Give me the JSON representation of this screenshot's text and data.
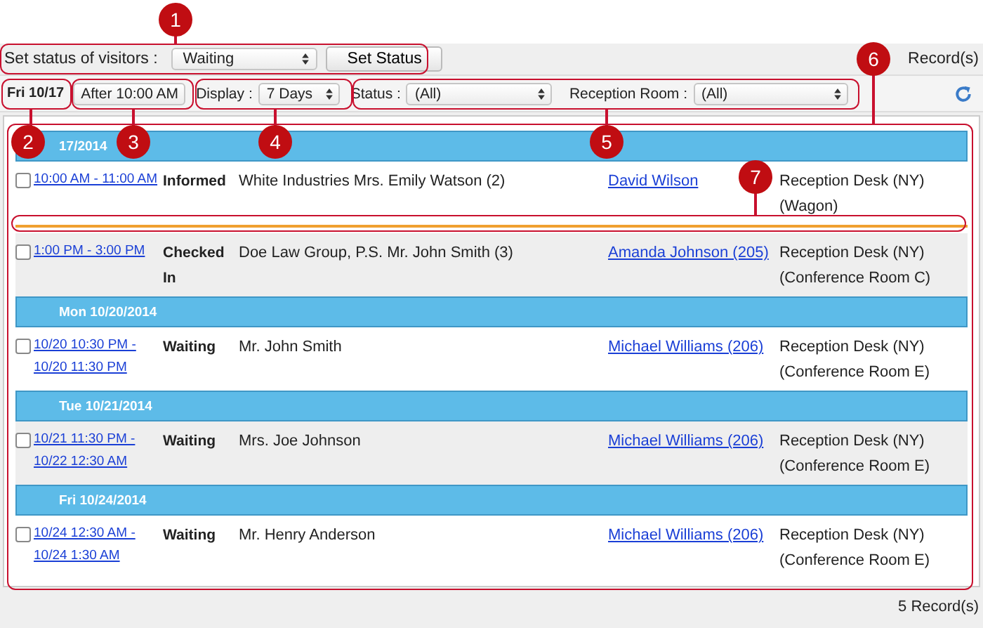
{
  "status_bar": {
    "label": "Set status of visitors :",
    "select": "Waiting",
    "button": "Set Status",
    "records_top": "Record(s)"
  },
  "filters": {
    "date": "Fri 10/17",
    "time": "After 10:00 AM",
    "display_label": "Display :",
    "display": "7 Days",
    "status_label": "Status :",
    "status": "(All)",
    "room_label": "Reception Room :",
    "room": "(All)"
  },
  "groups": [
    {
      "date": "17/2014",
      "rows": [
        {
          "checked": false,
          "time": [
            "10:00 AM - 11:00 AM"
          ],
          "status": "Informed",
          "visitor": "White Industries Mrs. Emily Watson (2)",
          "host": "David Wilson",
          "location": [
            "Reception Desk (NY)",
            "(Wagon)"
          ]
        },
        {
          "checked": false,
          "time": [
            "1:00 PM - 3:00 PM"
          ],
          "status": "Checked In",
          "visitor": "Doe Law Group, P.S. Mr. John Smith (3)",
          "host": "Amanda Johnson (205)",
          "location": [
            "Reception Desk (NY)",
            "(Conference Room C)"
          ]
        }
      ]
    },
    {
      "date": "Mon 10/20/2014",
      "rows": [
        {
          "checked": false,
          "time": [
            "10/20 10:30 PM -",
            "10/20 11:30 PM"
          ],
          "status": "Waiting",
          "visitor": "Mr. John Smith",
          "host": "Michael Williams (206)",
          "location": [
            "Reception Desk (NY)",
            "(Conference Room E)"
          ]
        }
      ]
    },
    {
      "date": "Tue 10/21/2014",
      "rows": [
        {
          "checked": false,
          "time": [
            "10/21 11:30 PM -",
            "10/22 12:30 AM"
          ],
          "status": "Waiting",
          "visitor": "Mrs. Joe Johnson",
          "host": "Michael Williams (206)",
          "location": [
            "Reception Desk (NY)",
            "(Conference Room E)"
          ]
        }
      ]
    },
    {
      "date": "Fri 10/24/2014",
      "rows": [
        {
          "checked": false,
          "time": [
            "10/24 12:30 AM -",
            "10/24 1:30 AM"
          ],
          "status": "Waiting",
          "visitor": "Mr. Henry Anderson",
          "host": "Michael Williams (206)",
          "location": [
            "Reception Desk (NY)",
            "(Conference Room E)"
          ]
        }
      ]
    }
  ],
  "records_bottom": "5 Record(s)",
  "callouts": [
    {
      "number": "1"
    },
    {
      "number": "2"
    },
    {
      "number": "3"
    },
    {
      "number": "4"
    },
    {
      "number": "5"
    },
    {
      "number": "6"
    },
    {
      "number": "7"
    }
  ]
}
